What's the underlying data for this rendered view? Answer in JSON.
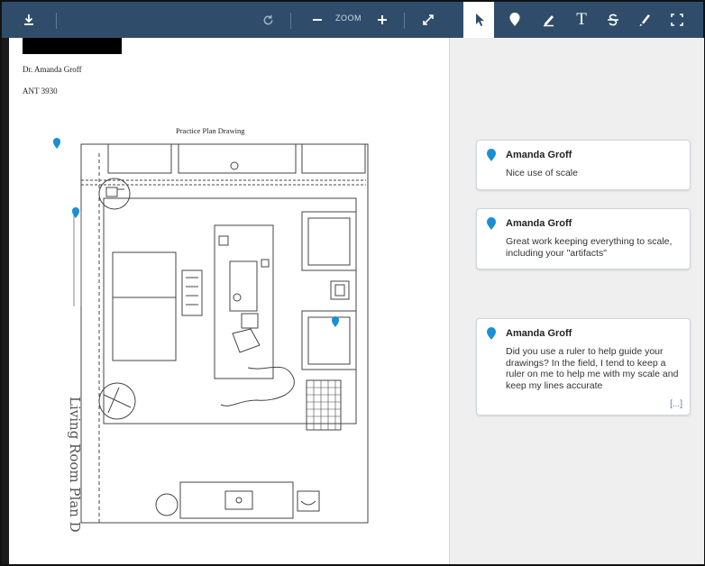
{
  "toolbar": {
    "zoom_label": "ZOOM",
    "icons": [
      "download-icon",
      "rotate-icon",
      "zoom-out-icon",
      "zoom-in-icon",
      "expand-icon",
      "select-icon",
      "pin-icon",
      "draw-icon",
      "text-icon",
      "strikethrough-icon",
      "highlight-icon",
      "area-icon"
    ]
  },
  "document": {
    "name_line": "Dr. Amanda Groff",
    "course_line": "ANT 3930",
    "drawing_title": "Practice Plan Drawing",
    "side_note_a": "Living Room Plan Drawing"
  },
  "comments": [
    {
      "author": "Amanda Groff",
      "text": "Nice use of scale"
    },
    {
      "author": "Amanda Groff",
      "text": "Great work keeping everything to scale, including your \"artifacts\""
    },
    {
      "author": "Amanda Groff",
      "text": "Did you use a ruler to help guide your drawings? In the field, I tend to keep a ruler on me to help me with my scale and keep my lines accurate",
      "more": "[...]"
    }
  ],
  "colors": {
    "toolbar": "#2f4d6b",
    "pin": "#1b8ed6",
    "sidebar": "#efefef"
  }
}
